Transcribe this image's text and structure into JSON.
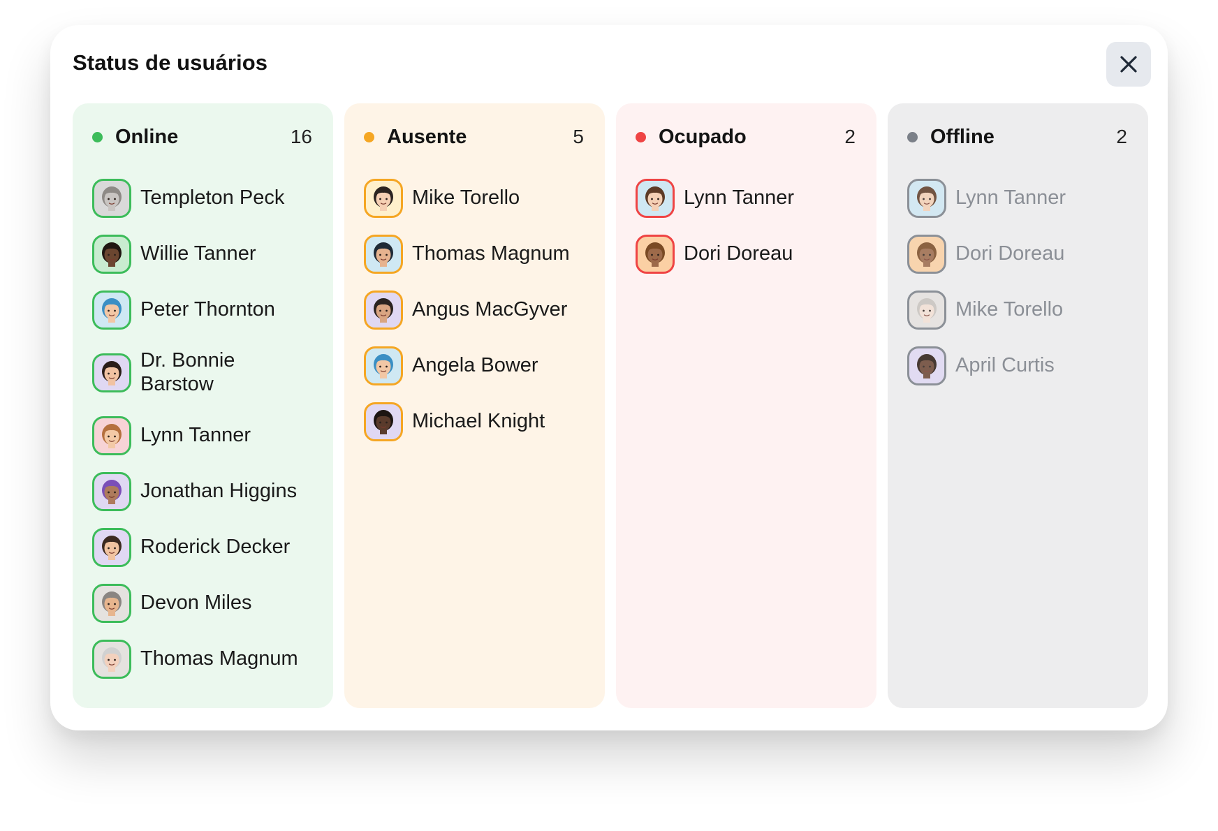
{
  "modal": {
    "title": "Status de usuários",
    "close_icon": "close-icon"
  },
  "columns": [
    {
      "id": "online",
      "title": "Online",
      "count": "16",
      "accent": "#3cbc5a",
      "background": "#ebf8ee",
      "users": [
        {
          "name": "Templeton Peck",
          "avatar_bg": "#d9d9d9",
          "skin": "#c9c5c2",
          "hair": "#8e8a86"
        },
        {
          "name": "Willie Tanner",
          "avatar_bg": "#c9ecd0",
          "skin": "#6b4630",
          "hair": "#1f1611"
        },
        {
          "name": "Peter Thornton",
          "avatar_bg": "#cfe8f3",
          "skin": "#f2c7a5",
          "hair": "#3a8fc4"
        },
        {
          "name": "Dr. Bonnie Barstow",
          "avatar_bg": "#e0d8f3",
          "skin": "#f1c2a2",
          "hair": "#2a1d18"
        },
        {
          "name": "Lynn Tanner",
          "avatar_bg": "#f7d3d6",
          "skin": "#f3c9a6",
          "hair": "#b5703e"
        },
        {
          "name": "Jonathan Higgins",
          "avatar_bg": "#e0d8f3",
          "skin": "#ae7b5d",
          "hair": "#7b4fb8"
        },
        {
          "name": "Roderick Decker",
          "avatar_bg": "#e0d8f3",
          "skin": "#f1c3a0",
          "hair": "#3c2a20"
        },
        {
          "name": "Devon Miles",
          "avatar_bg": "#e5e2df",
          "skin": "#e7b58e",
          "hair": "#8a8582"
        },
        {
          "name": "Thomas Magnum",
          "avatar_bg": "#e5e2df",
          "skin": "#f3d1bd",
          "hair": "#d1d1d1"
        }
      ]
    },
    {
      "id": "ausente",
      "title": "Ausente",
      "count": "5",
      "accent": "#f5a623",
      "background": "#fef4e7",
      "users": [
        {
          "name": "Mike Torello",
          "avatar_bg": "#fff0cc",
          "skin": "#f6d0b4",
          "hair": "#2c2420"
        },
        {
          "name": "Thomas Magnum",
          "avatar_bg": "#cfe8f3",
          "skin": "#e6b38f",
          "hair": "#1f2a36"
        },
        {
          "name": "Angus MacGyver",
          "avatar_bg": "#e0d8f3",
          "skin": "#d9a582",
          "hair": "#2a2320"
        },
        {
          "name": "Angela Bower",
          "avatar_bg": "#cfe8f3",
          "skin": "#f2c7a5",
          "hair": "#3a8fc4"
        },
        {
          "name": "Michael Knight",
          "avatar_bg": "#e0d8f3",
          "skin": "#5a3b2c",
          "hair": "#1d1512"
        }
      ]
    },
    {
      "id": "ocupado",
      "title": "Ocupado",
      "count": "2",
      "accent": "#ef4444",
      "background": "#fef2f2",
      "users": [
        {
          "name": "Lynn Tanner",
          "avatar_bg": "#cfe8f3",
          "skin": "#f4d0b5",
          "hair": "#5d3b26"
        },
        {
          "name": "Dori Doreau",
          "avatar_bg": "#fbd0a4",
          "skin": "#9d6a4a",
          "hair": "#7a4a24"
        }
      ]
    },
    {
      "id": "offline",
      "title": "Offline",
      "count": "2",
      "accent": "#7b8088",
      "background": "#ededee",
      "users": [
        {
          "name": "Lynn Tanner",
          "avatar_bg": "#cfe8f3",
          "skin": "#f4d0b5",
          "hair": "#5d3b26"
        },
        {
          "name": "Dori Doreau",
          "avatar_bg": "#fbd0a4",
          "skin": "#9d6a4a",
          "hair": "#7a4a24"
        },
        {
          "name": "Mike Torello",
          "avatar_bg": "#e5e2df",
          "skin": "#f3e1d5",
          "hair": "#c8c3bf"
        },
        {
          "name": "April Curtis",
          "avatar_bg": "#e0d8f3",
          "skin": "#6a4433",
          "hair": "#2a1a12"
        }
      ]
    }
  ]
}
